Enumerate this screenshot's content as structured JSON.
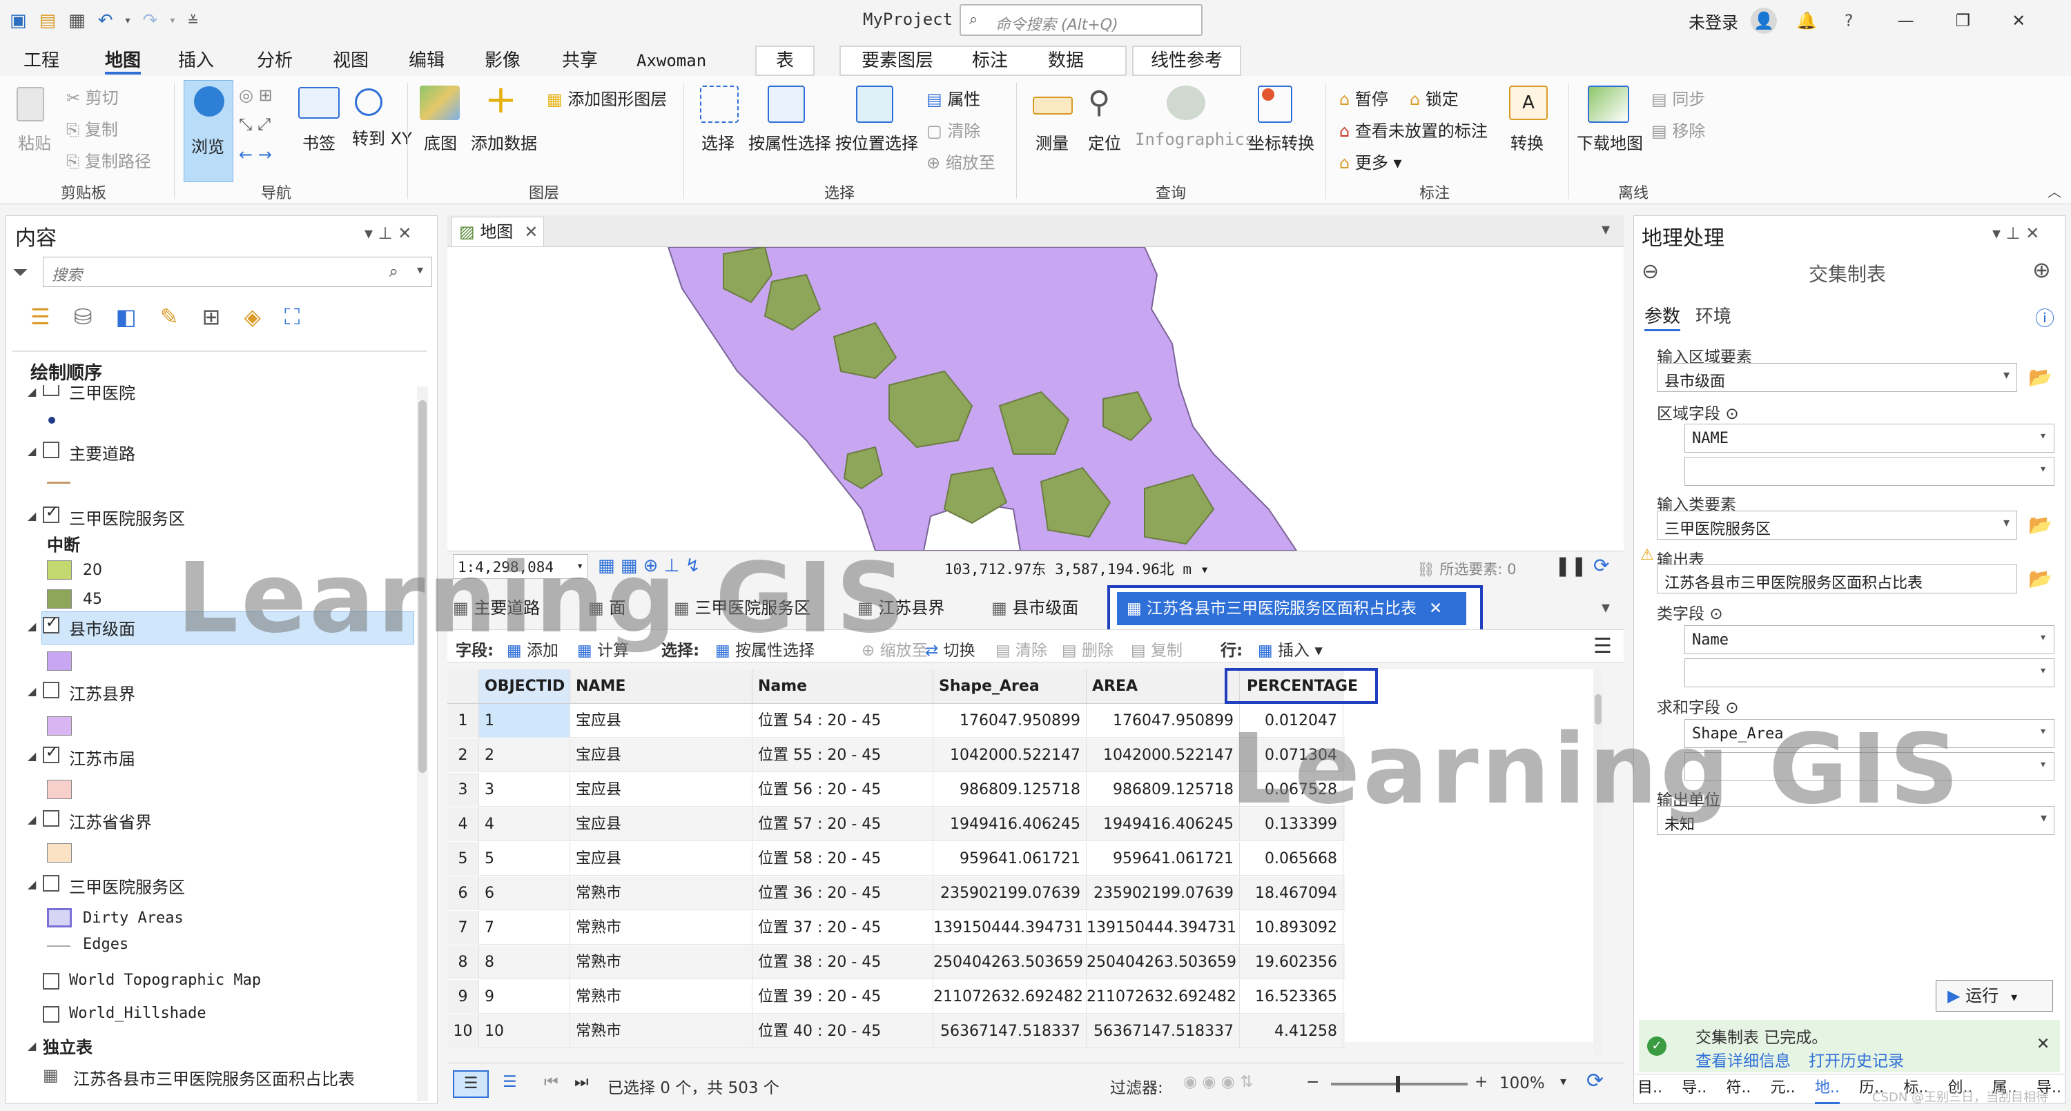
{
  "title_bar": {
    "project": "MyProject",
    "search_placeholder": "命令搜索 (Alt+Q)",
    "user": "未登录"
  },
  "tabs": [
    "工程",
    "地图",
    "插入",
    "分析",
    "视图",
    "编辑",
    "影像",
    "共享",
    "Axwoman"
  ],
  "active_tab": "地图",
  "context_tabs": [
    "表",
    "要素图层",
    "标注",
    "数据",
    "线性参考"
  ],
  "ribbon": {
    "clipboard": {
      "paste": "粘贴",
      "cut": "剪切",
      "copy": "复制",
      "copy_path": "复制路径",
      "group": "剪贴板"
    },
    "navigate": {
      "explore": "浏览",
      "bookmark": "书签",
      "goto_xy": "转到 XY",
      "group": "导航"
    },
    "layer": {
      "basemap": "底图",
      "add_data": "添加数据",
      "add_graphics": "添加图形图层",
      "group": "图层"
    },
    "selection": {
      "select": "选择",
      "by_attr": "按属性选择",
      "by_loc": "按位置选择",
      "attributes": "属性",
      "clear": "清除",
      "zoom_to": "缩放至",
      "group": "选择"
    },
    "inquiry": {
      "measure": "测量",
      "locate": "定位",
      "infographics": "Infographics",
      "convert_coords": "坐标转换",
      "group": "查询"
    },
    "labeling": {
      "pause": "暂停",
      "lock": "锁定",
      "view_unplaced": "查看未放置的标注",
      "more": "更多",
      "convert": "转换",
      "group": "标注"
    },
    "offline": {
      "download": "下载地图",
      "sync": "同步",
      "remove": "移除",
      "group": "离线"
    }
  },
  "contents": {
    "title": "内容",
    "search_placeholder": "搜索",
    "draw_order": "绘制顺序",
    "layers": [
      {
        "name": "三甲医院",
        "checked": false
      },
      {
        "name": "主要道路",
        "checked": false
      },
      {
        "name": "三甲医院服务区",
        "checked": true
      },
      {
        "name": "县市级面",
        "checked": true
      },
      {
        "name": "江苏县界",
        "checked": false
      },
      {
        "name": "江苏市届",
        "checked": true
      },
      {
        "name": "江苏省省界",
        "checked": false
      },
      {
        "name": "三甲医院服务区",
        "checked": false
      },
      {
        "name": "World Topographic Map",
        "checked": false
      },
      {
        "name": "World_Hillshade",
        "checked": false
      }
    ],
    "legend_break": "中断",
    "legend_20": "20",
    "legend_45": "45",
    "dirty_areas": "Dirty Areas",
    "edges": "Edges",
    "standalone": "独立表",
    "standalone_table": "江苏各县市三甲医院服务区面积占比表"
  },
  "map": {
    "tab": "地图",
    "scale": "1:4,298,084",
    "coords": "103,712.97东  3,587,194.96北 m",
    "selected": "所选要素: 0"
  },
  "table_tabs": [
    "主要道路",
    "面",
    "三甲医院服务区",
    "江苏县界",
    "县市级面",
    "江苏各县市三甲医院服务区面积占比表"
  ],
  "table_toolbar": {
    "field": "字段:",
    "add": "添加",
    "calc": "计算",
    "select": "选择:",
    "by_attr": "按属性选择",
    "zoom": "缩放至",
    "switch": "切换",
    "clear": "清除",
    "delete": "删除",
    "copy": "复制",
    "rows": "行:",
    "insert": "插入"
  },
  "columns": [
    "OBJECTID *",
    "NAME",
    "Name",
    "Shape_Area",
    "AREA",
    "PERCENTAGE"
  ],
  "rows": [
    [
      "1",
      "1",
      "宝应县",
      "位置 54 : 20 - 45",
      "176047.950899",
      "176047.950899",
      "0.012047"
    ],
    [
      "2",
      "2",
      "宝应县",
      "位置 55 : 20 - 45",
      "1042000.522147",
      "1042000.522147",
      "0.071304"
    ],
    [
      "3",
      "3",
      "宝应县",
      "位置 56 : 20 - 45",
      "986809.125718",
      "986809.125718",
      "0.067528"
    ],
    [
      "4",
      "4",
      "宝应县",
      "位置 57 : 20 - 45",
      "1949416.406245",
      "1949416.406245",
      "0.133399"
    ],
    [
      "5",
      "5",
      "宝应县",
      "位置 58 : 20 - 45",
      "959641.061721",
      "959641.061721",
      "0.065668"
    ],
    [
      "6",
      "6",
      "常熟市",
      "位置 36 : 20 - 45",
      "235902199.07639",
      "235902199.07639",
      "18.467094"
    ],
    [
      "7",
      "7",
      "常熟市",
      "位置 37 : 20 - 45",
      "139150444.394731",
      "139150444.394731",
      "10.893092"
    ],
    [
      "8",
      "8",
      "常熟市",
      "位置 38 : 20 - 45",
      "250404263.503659",
      "250404263.503659",
      "19.602356"
    ],
    [
      "9",
      "9",
      "常熟市",
      "位置 39 : 20 - 45",
      "211072632.692482",
      "211072632.692482",
      "16.523365"
    ],
    [
      "10",
      "10",
      "常熟市",
      "位置 40 : 20 - 45",
      "56367147.518337",
      "56367147.518337",
      "4.41258"
    ]
  ],
  "table_status": {
    "selected": "已选择 0 个，共 503 个",
    "filter": "过滤器:",
    "zoom": "100%"
  },
  "geoprocessing": {
    "title": "地理处理",
    "tool": "交集制表",
    "tab_params": "参数",
    "tab_env": "环境",
    "in_zone_label": "输入区域要素",
    "in_zone": "县市级面",
    "zone_field_label": "区域字段",
    "zone_field": "NAME",
    "in_class_label": "输入类要素",
    "in_class": "三甲医院服务区",
    "out_table_label": "输出表",
    "out_table": "江苏各县市三甲医院服务区面积占比表",
    "class_field_label": "类字段",
    "class_field": "Name",
    "sum_field_label": "求和字段",
    "sum_field": "Shape_Area",
    "out_units_label": "输出单位",
    "out_units": "未知",
    "run": "运行",
    "done_msg": "交集制表 已完成。",
    "view_details": "查看详细信息",
    "open_history": "打开历史记录",
    "bottom_tabs": [
      "目..",
      "导..",
      "符..",
      "元..",
      "地..",
      "历..",
      "标..",
      "创..",
      "属..",
      "导.."
    ]
  },
  "watermark": "Learning GIS",
  "credit": "CSDN @王别三日，当刮目相待",
  "colors": {
    "accent": "#2e6fd8",
    "highlight": "#1f3fbf",
    "county_fill": "#c9a6f2",
    "service_fill": "#8ea65a"
  }
}
